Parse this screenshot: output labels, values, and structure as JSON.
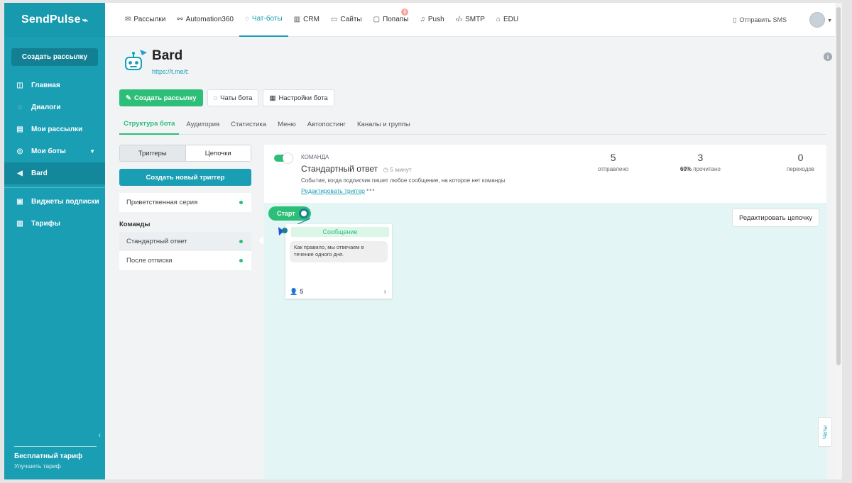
{
  "brand": {
    "name": "SendPulse",
    "pulse_glyph": "⌁"
  },
  "sidebar": {
    "create_label": "Создать рассылку",
    "items": [
      {
        "label": "Главная",
        "icon": "home-icon"
      },
      {
        "label": "Диалоги",
        "icon": "chat-icon"
      },
      {
        "label": "Мои рассылки",
        "icon": "mail-list-icon"
      },
      {
        "label": "Мои боты",
        "icon": "bot-icon"
      },
      {
        "label": "Bard",
        "icon": "telegram-icon"
      },
      {
        "label": "Виджеты подписки",
        "icon": "widget-icon"
      },
      {
        "label": "Тарифы",
        "icon": "tariff-icon"
      }
    ],
    "plan_title": "Бесплатный тариф",
    "plan_upgrade": "Улучшить тариф"
  },
  "topnav": {
    "items": [
      {
        "label": "Рассылки",
        "icon": "mail-icon"
      },
      {
        "label": "Automation360",
        "icon": "flow-icon"
      },
      {
        "label": "Чат-боты",
        "icon": "chatbot-icon"
      },
      {
        "label": "CRM",
        "icon": "crm-icon"
      },
      {
        "label": "Сайты",
        "icon": "sites-icon"
      },
      {
        "label": "Попапы",
        "icon": "popup-icon"
      },
      {
        "label": "Push",
        "icon": "bell-icon"
      },
      {
        "label": "SMTP",
        "icon": "code-icon"
      },
      {
        "label": "EDU",
        "icon": "edu-icon"
      }
    ],
    "popups_badge": "β",
    "sms_label": "Отправить SMS"
  },
  "bot": {
    "name": "Bard",
    "link": "https://t.me/t:"
  },
  "actions": {
    "create": "Создать рассылку",
    "chats": "Чаты бота",
    "settings": "Настройки бота"
  },
  "tabs": [
    "Структура бота",
    "Аудитория",
    "Статистика",
    "Меню",
    "Автопостинг",
    "Каналы и группы"
  ],
  "left": {
    "seg_triggers": "Триггеры",
    "seg_chains": "Цепочки",
    "new_trigger": "Создать новый триггер",
    "welcome": "Приветственная серия",
    "commands_label": "Команды",
    "commands": [
      "Стандартный ответ",
      "После отписки"
    ]
  },
  "trigger": {
    "kind": "команда",
    "title": "Стандартный ответ",
    "time": "5 минут",
    "description": "Событие, когда подписчик пишет любое сообщение, на которое нет команды",
    "edit": "Редактировать триггер",
    "more": "•••",
    "stats": {
      "sent_value": "5",
      "sent_label": "отправлено",
      "read_value": "3",
      "read_pct": "60%",
      "read_label": "прочитано",
      "clicks_value": "0",
      "clicks_label": "переходов"
    }
  },
  "canvas": {
    "start": "Старт",
    "edit_chain": "Редактировать цепочку",
    "message_title": "Сообщение",
    "message_text": "Как правило, мы отвечаем в течение одного дня.",
    "message_count": "5"
  },
  "chats_tab": "Чаты",
  "colors": {
    "sidebar": "#1a9eb4",
    "accent_green": "#2dbe78",
    "canvas_bg": "#e3f5f5"
  }
}
